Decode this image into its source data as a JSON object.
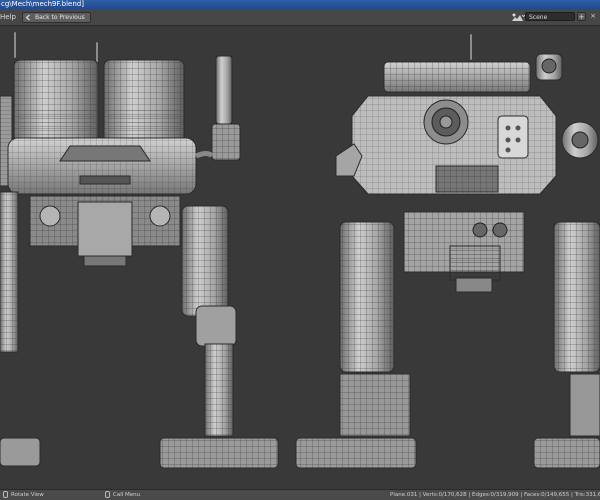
{
  "window": {
    "title": "cg\\Mech\\mech9F.blend]"
  },
  "header": {
    "menu_help": "Help",
    "back_button": "Back to Previous",
    "scene_field": "Scene",
    "scene_add": "+",
    "scene_close": "×"
  },
  "viewport": {
    "content": "mech-model-front-and-back-views"
  },
  "statusbar": {
    "left_hint": "Rotate View",
    "middle_hint": "Call Menu",
    "stats": "Plane.031 | Verts:0/170,628 | Edges:0/319,909 | Faces:0/149,655 | Tris:331,616 | Obj"
  },
  "colors": {
    "title_blue": "#2f5fa8",
    "header": "#474747",
    "viewport_bg": "#393939",
    "mech_light": "#bdbdbd",
    "mech_mid": "#8f8f8f",
    "mech_dark": "#555555"
  }
}
